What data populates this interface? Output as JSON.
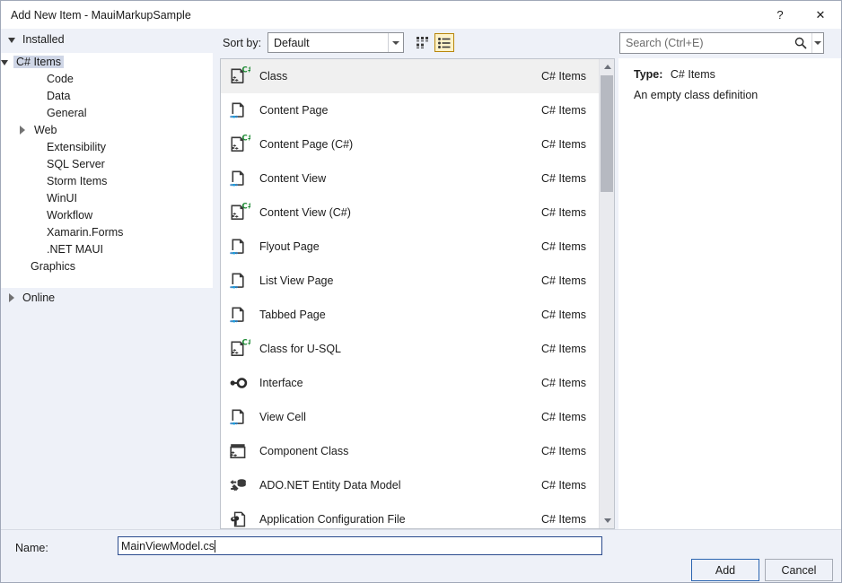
{
  "window": {
    "title": "Add New Item - MauiMarkupSample",
    "help_button": "?",
    "close_button": "✕"
  },
  "sidebar": {
    "installed_header": "Installed",
    "online_header": "Online",
    "tree": [
      {
        "label": "C# Items",
        "indent": 14,
        "arrow": "down",
        "selected": true
      },
      {
        "label": "Code",
        "indent": 48,
        "arrow": "none",
        "selected": false
      },
      {
        "label": "Data",
        "indent": 48,
        "arrow": "none",
        "selected": false
      },
      {
        "label": "General",
        "indent": 48,
        "arrow": "none",
        "selected": false
      },
      {
        "label": "Web",
        "indent": 34,
        "arrow": "right",
        "selected": false
      },
      {
        "label": "Extensibility",
        "indent": 48,
        "arrow": "none",
        "selected": false
      },
      {
        "label": "SQL Server",
        "indent": 48,
        "arrow": "none",
        "selected": false
      },
      {
        "label": "Storm Items",
        "indent": 48,
        "arrow": "none",
        "selected": false
      },
      {
        "label": "WinUI",
        "indent": 48,
        "arrow": "none",
        "selected": false
      },
      {
        "label": "Workflow",
        "indent": 48,
        "arrow": "none",
        "selected": false
      },
      {
        "label": "Xamarin.Forms",
        "indent": 48,
        "arrow": "none",
        "selected": false
      },
      {
        "label": ".NET MAUI",
        "indent": 48,
        "arrow": "none",
        "selected": false
      },
      {
        "label": "Graphics",
        "indent": 30,
        "arrow": "none",
        "selected": false
      }
    ]
  },
  "toolbar": {
    "sort_label": "Sort by:",
    "sort_value": "Default",
    "sort_options": [
      "Default"
    ],
    "tiles_view_tooltip": "Medium Icons",
    "list_view_tooltip": "List",
    "list_view_selected": true,
    "selected_accent": "#b8860b"
  },
  "search": {
    "placeholder": "Search (Ctrl+E)",
    "value": ""
  },
  "item_list": {
    "selected_index": 0,
    "items": [
      {
        "name": "Class",
        "category": "C# Items",
        "icon": "csharp-class-icon"
      },
      {
        "name": "Content Page",
        "category": "C# Items",
        "icon": "xaml-page-icon"
      },
      {
        "name": "Content Page (C#)",
        "category": "C# Items",
        "icon": "csharp-class-icon"
      },
      {
        "name": "Content View",
        "category": "C# Items",
        "icon": "xaml-page-icon"
      },
      {
        "name": "Content View (C#)",
        "category": "C# Items",
        "icon": "csharp-class-icon"
      },
      {
        "name": "Flyout Page",
        "category": "C# Items",
        "icon": "xaml-page-icon"
      },
      {
        "name": "List View Page",
        "category": "C# Items",
        "icon": "xaml-page-icon"
      },
      {
        "name": "Tabbed Page",
        "category": "C# Items",
        "icon": "xaml-page-icon"
      },
      {
        "name": "Class for U-SQL",
        "category": "C# Items",
        "icon": "csharp-class-icon"
      },
      {
        "name": "Interface",
        "category": "C# Items",
        "icon": "interface-icon"
      },
      {
        "name": "View Cell",
        "category": "C# Items",
        "icon": "xaml-page-icon"
      },
      {
        "name": "Component Class",
        "category": "C# Items",
        "icon": "component-class-icon"
      },
      {
        "name": "ADO.NET Entity Data Model",
        "category": "C# Items",
        "icon": "entity-data-model-icon"
      },
      {
        "name": "Application Configuration File",
        "category": "C# Items",
        "icon": "config-file-icon"
      }
    ]
  },
  "details": {
    "type_label": "Type:",
    "type_value": "C# Items",
    "description": "An empty class definition"
  },
  "footer": {
    "name_label": "Name:",
    "name_value": "MainViewModel.cs",
    "add_label": "Add",
    "cancel_label": "Cancel"
  }
}
